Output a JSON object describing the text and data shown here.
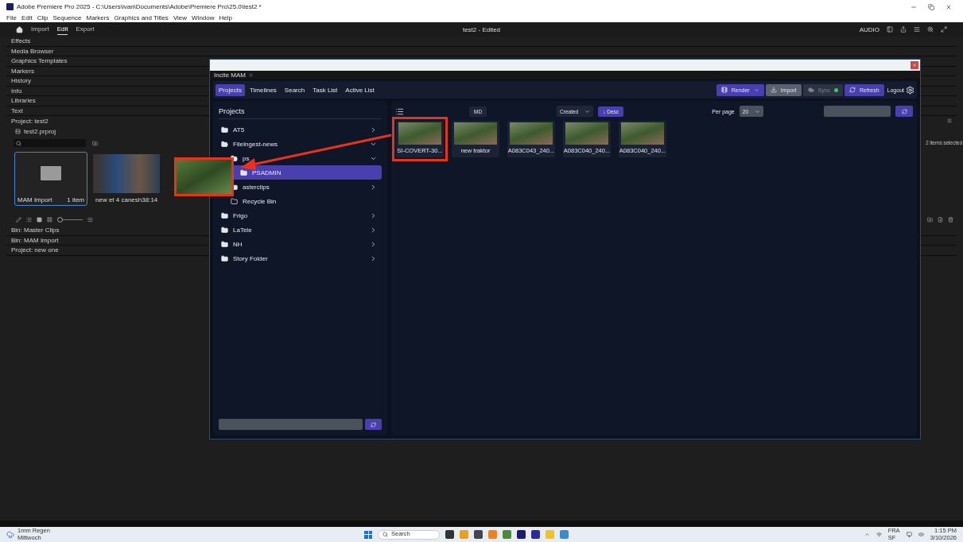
{
  "window": {
    "title": "Adobe Premiere Pro 2025 - C:\\Users\\ivan\\Documents\\Adobe\\Premiere Pro\\25.0\\test2 *"
  },
  "menu": [
    "File",
    "Edit",
    "Clip",
    "Sequence",
    "Markers",
    "Graphics and Titles",
    "View",
    "Window",
    "Help"
  ],
  "workspace_tabs": [
    {
      "label": "Import",
      "selected": false
    },
    {
      "label": "Edit",
      "selected": true
    },
    {
      "label": "Export",
      "selected": false
    }
  ],
  "document_title": "test2 - Edited",
  "audio_label": "AUDIO",
  "panels": [
    "Effects",
    "Media Browser",
    "Graphics Templates",
    "Markers",
    "History",
    "Info",
    "Libraries",
    "Text"
  ],
  "project": {
    "title": "Project: test2",
    "file": "test2.prproj",
    "selection": "2 items selected",
    "items": [
      {
        "kind": "bin",
        "name": "MAM Import",
        "meta": "1 item",
        "selected": true
      },
      {
        "kind": "clip",
        "name": "new et 4 canesh",
        "meta": "38:14",
        "selected": false
      }
    ]
  },
  "zoom_slider": {
    "level": 0.1
  },
  "bins": [
    "Bin: Master Clips",
    "Bin: MAM Import",
    "Project: new one"
  ],
  "mam": {
    "title": "Incite MAM",
    "tabs": [
      {
        "label": "Projects",
        "selected": true
      },
      {
        "label": "Timelines",
        "selected": false
      },
      {
        "label": "Search",
        "selected": false
      },
      {
        "label": "Task List",
        "selected": false
      },
      {
        "label": "Active List",
        "selected": false
      }
    ],
    "actions": [
      {
        "kind": "render",
        "label": "Render",
        "disabled": false
      },
      {
        "kind": "import",
        "label": "Import",
        "disabled": false
      },
      {
        "kind": "sync",
        "label": "Sync",
        "disabled": true
      },
      {
        "kind": "refresh",
        "label": "Refresh",
        "disabled": false
      }
    ],
    "logout": "Logout",
    "sidebar": {
      "title": "Projects",
      "items": [
        {
          "kind": "folder",
          "label": "AT5",
          "expanded": false,
          "selected": false
        },
        {
          "kind": "folder",
          "label": "FileIngest-news",
          "expanded": true,
          "selected": false,
          "children": [
            {
              "kind": "folder",
              "label": "ps",
              "expanded": true,
              "selected": false,
              "children": [
                {
                  "kind": "folder",
                  "label": "PSADMIN",
                  "selected": true
                }
              ]
            },
            {
              "kind": "folder",
              "label": "asterclips",
              "expanded": false,
              "selected": false
            },
            {
              "kind": "recycle",
              "label": "Recycle Bin",
              "selected": false
            }
          ]
        },
        {
          "kind": "folder",
          "label": "Frigo",
          "expanded": false,
          "selected": false
        },
        {
          "kind": "folder",
          "label": "LaTele",
          "expanded": false,
          "selected": false
        },
        {
          "kind": "folder",
          "label": "NH",
          "expanded": false,
          "selected": false
        },
        {
          "kind": "folder",
          "label": "Story Folder",
          "expanded": false,
          "selected": false
        }
      ]
    },
    "toolbar": {
      "metadata": "MD",
      "sort": "Created",
      "order": "↓ Desc",
      "per_page_label": "Per page",
      "per_page": "20"
    },
    "clips": [
      {
        "name": "SI-COVERT-30...",
        "highlighted": true
      },
      {
        "name": "new traktor",
        "highlighted": false
      },
      {
        "name": "A083C043_240...",
        "highlighted": false
      },
      {
        "name": "A083C040_240...",
        "highlighted": false
      },
      {
        "name": "A083C040_240...",
        "highlighted": false
      }
    ]
  },
  "taskbar": {
    "weather": "1mm Regen",
    "day": "Mittwoch",
    "search": "Search",
    "language": "FRA",
    "layout": "SF",
    "time": "1:15 PM",
    "date": "3/10/2026"
  }
}
